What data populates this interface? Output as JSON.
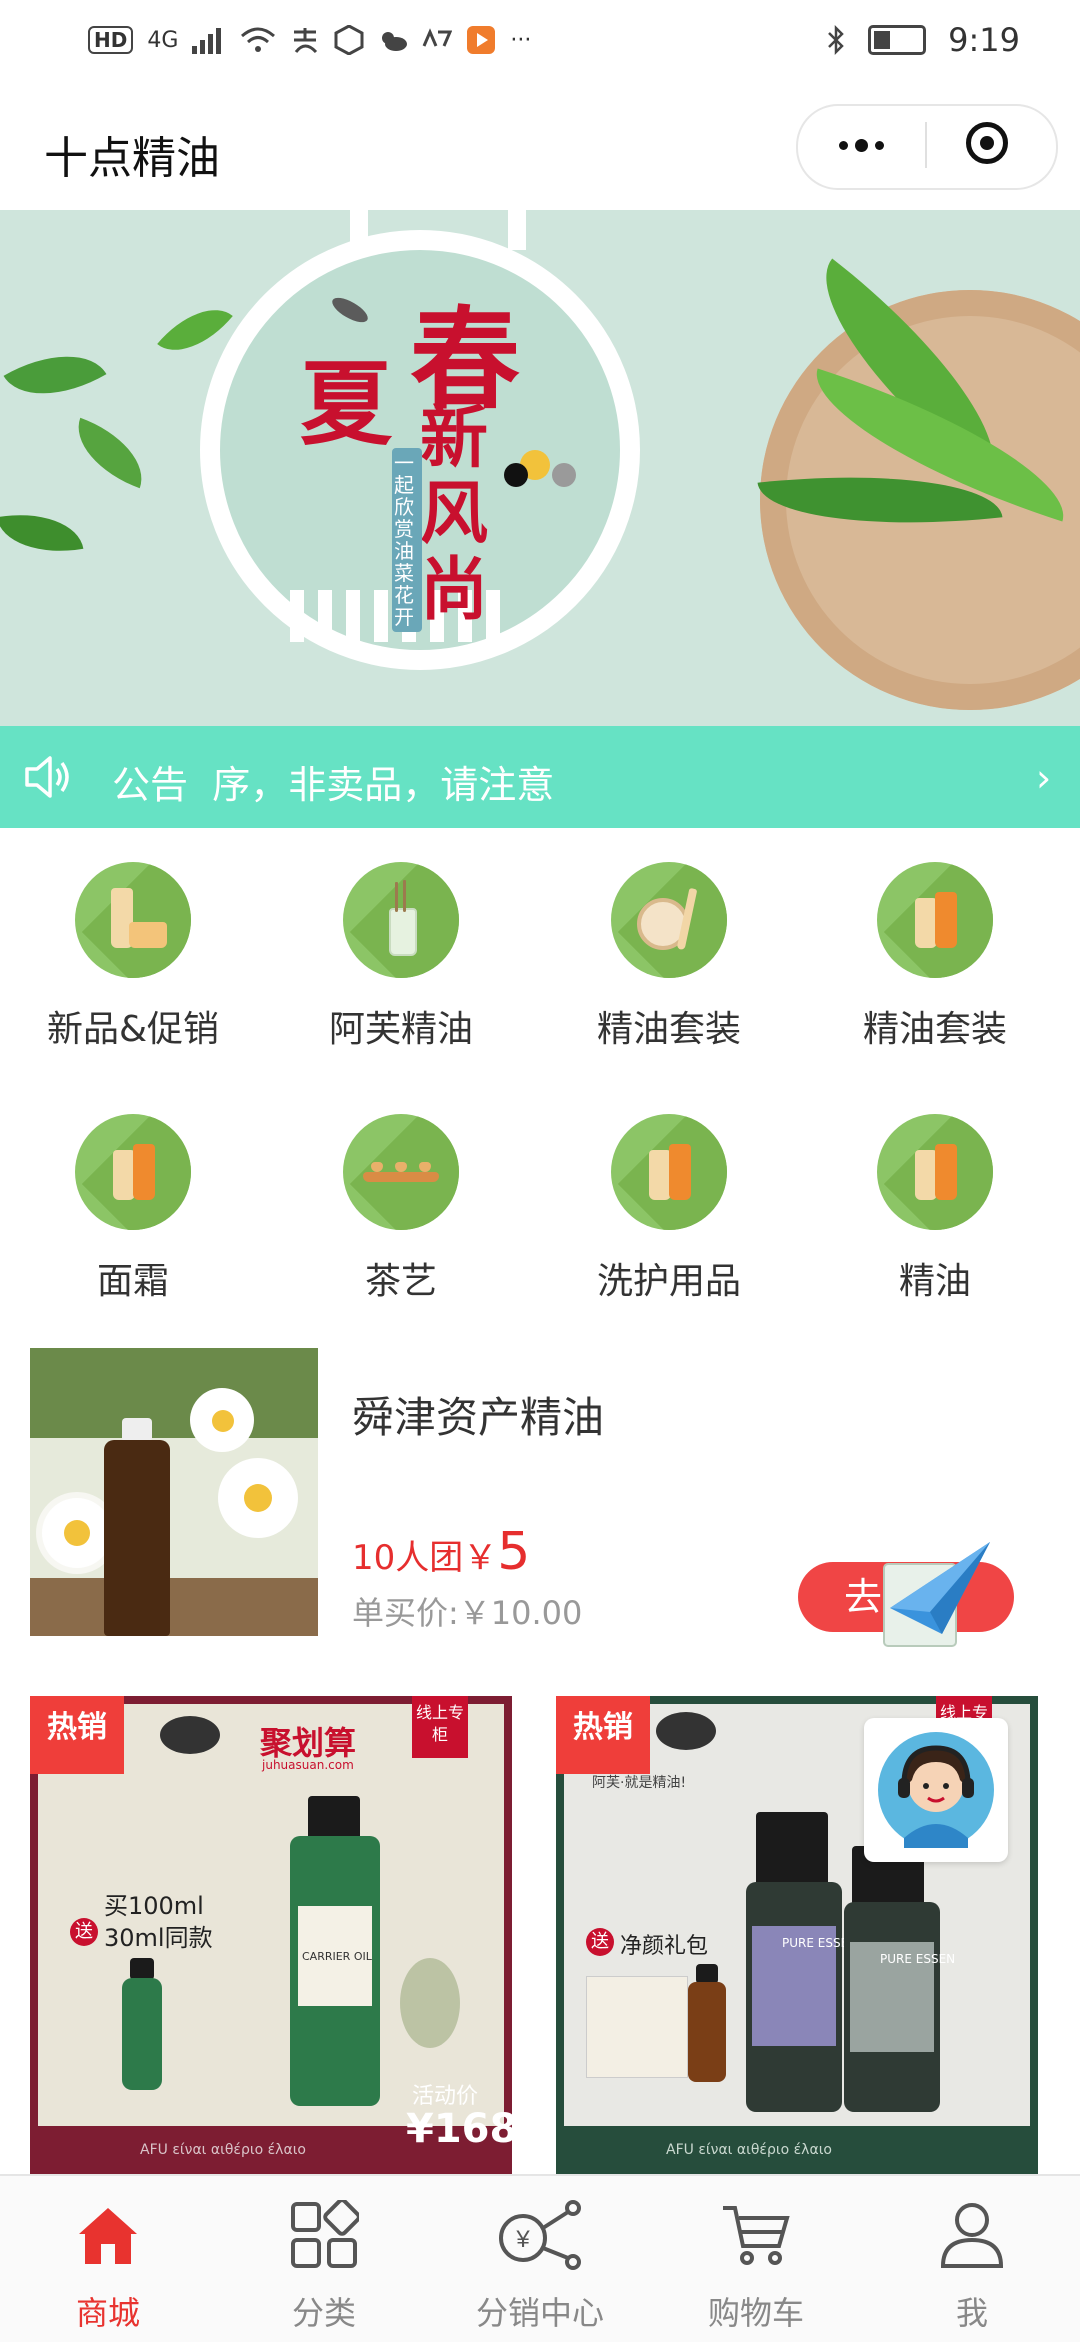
{
  "status_bar": {
    "network": "HD",
    "signal": "4G",
    "time": "9:19"
  },
  "header": {
    "title": "十点精油"
  },
  "banner": {
    "title_chars": [
      "春",
      "夏"
    ],
    "subtitle": "新风尚",
    "slogan": "一起欣赏油菜花开",
    "slides": 2,
    "active_slide": 0
  },
  "notice": {
    "label": "公告",
    "text": "序，非卖品，请注意"
  },
  "categories": [
    {
      "label": "新品&促销",
      "icon": "cosmetics-icon"
    },
    {
      "label": "阿芙精油",
      "icon": "diffuser-icon"
    },
    {
      "label": "精油套装",
      "icon": "compact-brush-icon"
    },
    {
      "label": "精油套装",
      "icon": "pump-bottles-icon"
    },
    {
      "label": "面霜",
      "icon": "pump-bottles-icon"
    },
    {
      "label": "茶艺",
      "icon": "tea-set-icon"
    },
    {
      "label": "洗护用品",
      "icon": "pump-bottles-icon"
    },
    {
      "label": "精油",
      "icon": "pump-bottles-icon"
    }
  ],
  "group_buy": {
    "title": "舜津资产精油",
    "group_label": "10人团￥",
    "group_price": "5",
    "single_price": "单买价:￥10.00",
    "button": "去"
  },
  "hot_products": [
    {
      "badge": "热销",
      "tag": "线上专柜",
      "brand": "聚划算",
      "brand_sub": "juhuasuan.com",
      "promo_line1": "买100ml",
      "promo_send": "送",
      "promo_line2": "30ml同款",
      "bottle_label": "CARRIER OIL",
      "price_label": "活动价",
      "price": "¥168",
      "footer": "AFU είναι αιθέριο έλαιο"
    },
    {
      "badge": "热销",
      "tag": "线上专柜",
      "brand_line": "阿芙·就是精油!",
      "promo_send": "送",
      "promo_text": "净颜礼包",
      "bottle_labels": [
        "PURE ESSEN",
        "PURE ESSEN"
      ],
      "footer": "AFU είναι αιθέριο έλαιο"
    }
  ],
  "tabbar": [
    {
      "label": "商城",
      "icon": "home-icon",
      "active": true
    },
    {
      "label": "分类",
      "icon": "grid-icon",
      "active": false
    },
    {
      "label": "分销中心",
      "icon": "share-yen-icon",
      "active": false
    },
    {
      "label": "购物车",
      "icon": "cart-icon",
      "active": false
    },
    {
      "label": "我",
      "icon": "user-icon",
      "active": false
    }
  ],
  "colors": {
    "accent_red": "#e8332f",
    "notice_bg": "#66e2c4",
    "category_green": "#8cc566"
  }
}
